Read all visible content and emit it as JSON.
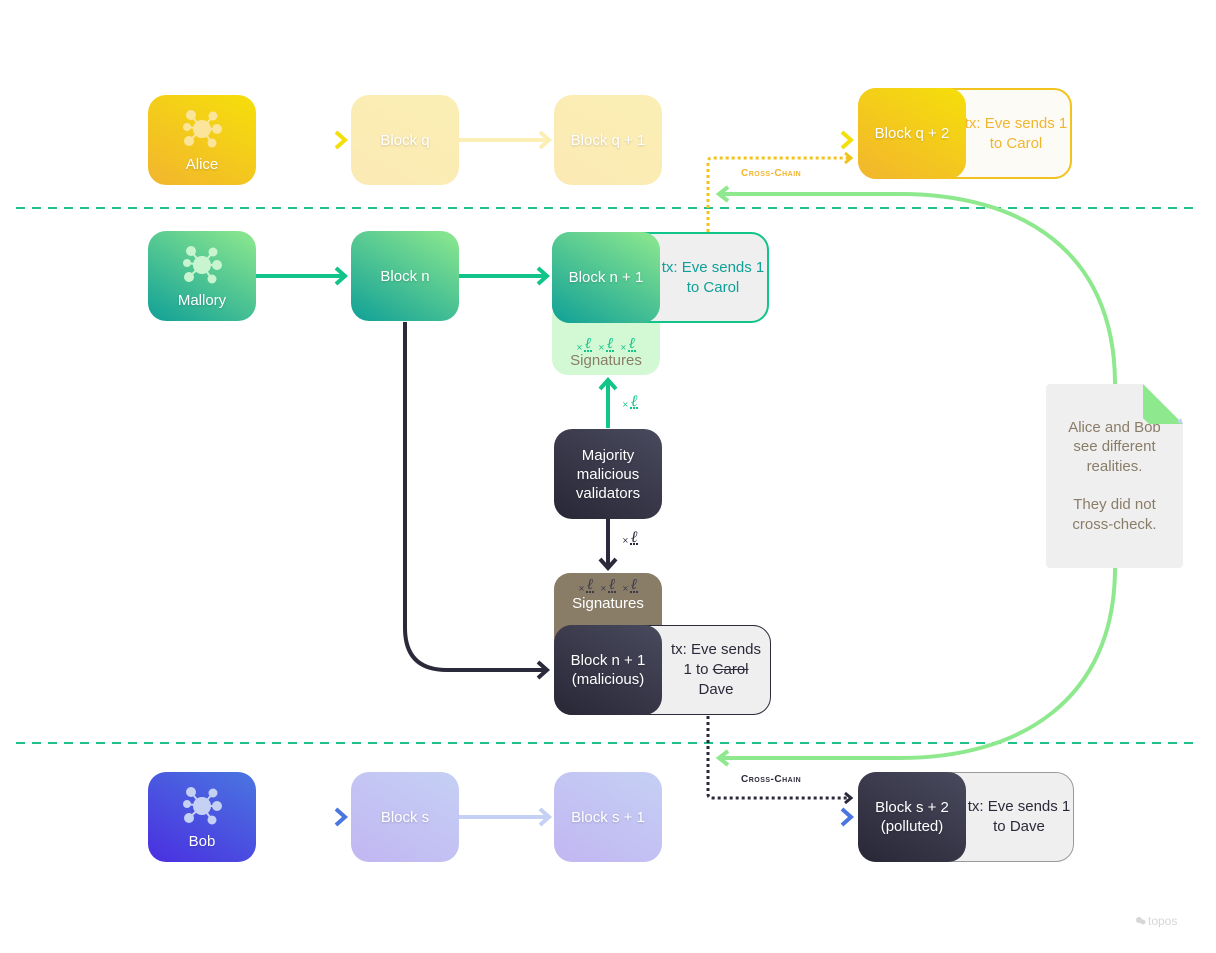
{
  "colors": {
    "yellow": "#f2c31c",
    "green": "#10c48a",
    "green_light": "#8ee98e",
    "dark": "#2a2a3a",
    "blue": "#4a55e0",
    "separator": "#1fc08a",
    "note_text": "#8a7d68",
    "signature_brown": "#8a7d68"
  },
  "lanes": {
    "alice": {
      "actor": {
        "label": "Alice",
        "icon": "network-hub-icon"
      },
      "blocks": [
        "Block q",
        "Block q + 1"
      ],
      "final_block": {
        "label": "Block q + 2",
        "tx": "tx: Eve sends 1 to Carol"
      },
      "cross_chain_label": "Cross-Chain"
    },
    "mallory": {
      "actor": {
        "label": "Mallory",
        "icon": "network-hub-icon"
      },
      "blocks": [
        "Block n"
      ],
      "honest_block": {
        "label": "Block n + 1",
        "tx": "tx: Eve sends 1 to Carol",
        "signatures_label": "Signatures"
      },
      "validators": {
        "label": "Majority malicious validators"
      },
      "malicious_block": {
        "label_line1": "Block n + 1",
        "label_line2": "(malicious)",
        "tx_line1": "tx: Eve sends",
        "tx_prefix": "1 to",
        "tx_struck": "Carol",
        "tx_line3": "Dave",
        "signatures_label": "Signatures"
      }
    },
    "bob": {
      "actor": {
        "label": "Bob",
        "icon": "network-hub-icon"
      },
      "blocks": [
        "Block s",
        "Block s + 1"
      ],
      "final_block": {
        "label_line1": "Block s + 2",
        "label_line2": "(polluted)",
        "tx": "tx: Eve sends 1 to Dave"
      },
      "cross_chain_label": "Cross-Chain"
    }
  },
  "note": {
    "line1": "Alice and Bob see different realities.",
    "line2": "They did not cross-check."
  },
  "signature_glyph": "ℓ",
  "signature_x": "×",
  "logo": {
    "text": "topos",
    "icon": "topos-logo-icon"
  }
}
